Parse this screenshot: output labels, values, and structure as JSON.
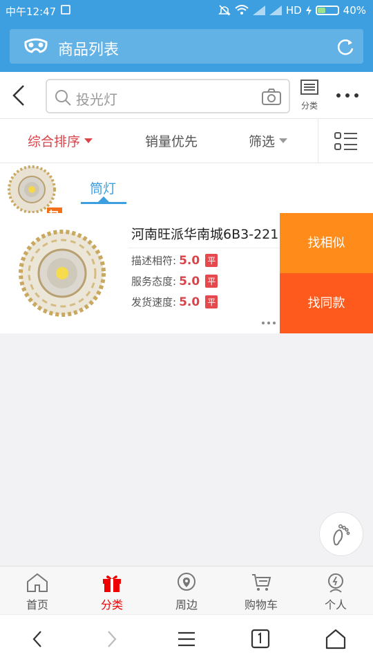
{
  "status_bar": {
    "time": "中午12:47",
    "network": "HD",
    "battery": "40%",
    "battery_level": 0.4
  },
  "app_bar": {
    "title": "商品列表",
    "logo_icon": "mask-logo-icon",
    "refresh_icon": "refresh-icon"
  },
  "search": {
    "placeholder": "投光灯",
    "category_label": "分类"
  },
  "sort": {
    "options": [
      "综合排序",
      "销量优先",
      "筛选"
    ],
    "active_index": 0
  },
  "image_tabs": {
    "tab_label": "筒灯"
  },
  "product": {
    "name": "河南旺派华南城6B3-221",
    "ratings": [
      {
        "label": "描述相符:",
        "score": "5.0",
        "badge": "平"
      },
      {
        "label": "服务态度:",
        "score": "5.0",
        "badge": "平"
      },
      {
        "label": "发货速度:",
        "score": "5.0",
        "badge": "平"
      }
    ],
    "actions": [
      "找相似",
      "找同款"
    ]
  },
  "tab_bar": {
    "items": [
      "首页",
      "分类",
      "周边",
      "购物车",
      "个人"
    ],
    "active_index": 1
  },
  "colors": {
    "primary": "#3d9fe0",
    "accent_red": "#d8444a",
    "orange": "#ff8c1a",
    "deep_orange": "#fe5a1d"
  }
}
